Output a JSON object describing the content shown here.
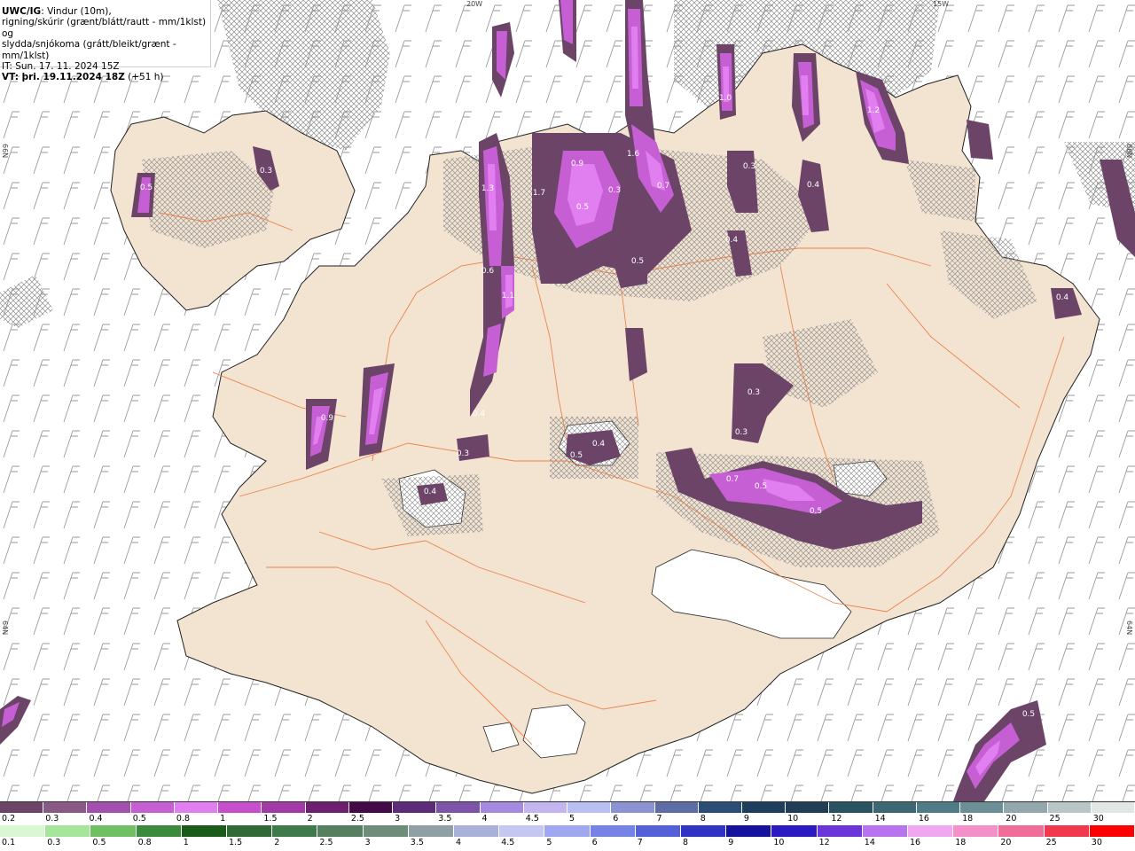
{
  "header": {
    "model": "UWC/IG",
    "desc_line1": ": Vindur (10m),",
    "desc_line2": "rigning/skúrir (grænt/blátt/rautt - mm/1klst) og",
    "desc_line3": "slydda/snjókoma (grátt/bleikt/grænt - mm/1klst)",
    "it_line": "IT: Sun. 17. 11. 2024 15Z",
    "vt_label": "VT: þri. 19.11.2024 18Z",
    "vt_lead": " (+51 h)"
  },
  "graticule": {
    "lon_top_1": "20W",
    "lon_top_2": "15W",
    "lat_left_1": "66N",
    "lat_left_2": "64N",
    "lat_right_1": "66N",
    "lat_right_2": "64N"
  },
  "map_labels": [
    "1.0",
    "1.2",
    "1.3",
    "1.7",
    "0.5",
    "0.3",
    "0.9",
    "0.6",
    "1.1",
    "1.6",
    "0.4",
    "0.3",
    "0.5",
    "0.7",
    "0.9",
    "0.4",
    "0.5",
    "0.4",
    "0.3",
    "0.4",
    "0.7",
    "0.5",
    "0.3",
    "0.5",
    "0.4",
    "0.3",
    "0.5",
    "0.4",
    "0.3",
    "0.5"
  ],
  "colors": {
    "land": "#f3e3d1",
    "ocean": "#ffffff",
    "snow_dark": "#6b4468",
    "snow_mid": "#a24fb0",
    "snow_light": "#e27ff0",
    "roads": "#e8743a",
    "hatch": "#9a9a9a",
    "coast": "#222222"
  },
  "legend_snow": {
    "labels": [
      "0.2",
      "0.3",
      "0.4",
      "0.5",
      "0.8",
      "1",
      "1.5",
      "2",
      "2.5",
      "3",
      "3.5",
      "4",
      "4.5",
      "5",
      "6",
      "7",
      "8",
      "9",
      "10",
      "12",
      "14",
      "16",
      "18",
      "20",
      "25",
      "30"
    ],
    "colors": [
      "#6b4468",
      "#8a5a86",
      "#a24fb0",
      "#c65fd4",
      "#e27ff0",
      "#c74fce",
      "#a23aa8",
      "#6e1f72",
      "#430a47",
      "#5c2c7a",
      "#7e54a8",
      "#a68ae0",
      "#c4b4f0",
      "#b9bff2",
      "#8c93d2",
      "#5f6da6",
      "#2c4d78",
      "#1d3e5c",
      "#203f57",
      "#2a5361",
      "#3e6774",
      "#4f7c86",
      "#6d8f98",
      "#93a8ad",
      "#b9c6c8",
      "#e3e6e6"
    ]
  },
  "legend_rain": {
    "labels": [
      "0.1",
      "0.3",
      "0.5",
      "0.8",
      "1",
      "1.5",
      "2",
      "2.5",
      "3",
      "3.5",
      "4",
      "4.5",
      "5",
      "6",
      "7",
      "8",
      "9",
      "10",
      "12",
      "14",
      "16",
      "18",
      "20",
      "25",
      "30"
    ],
    "colors": [
      "#d9f7d2",
      "#a6e69b",
      "#6fc062",
      "#3c8a3c",
      "#1a5b1a",
      "#2f6a37",
      "#3e7a4a",
      "#567f61",
      "#6d8d7a",
      "#8ea0a4",
      "#a9b1d8",
      "#c4c7f0",
      "#9ea7f0",
      "#7683e6",
      "#5460d8",
      "#3034c2",
      "#15139e",
      "#2a1abf",
      "#6a35d9",
      "#b774ee",
      "#f1a6f2",
      "#f58fc7",
      "#f06d99",
      "#f0394c",
      "#ff0000"
    ]
  }
}
